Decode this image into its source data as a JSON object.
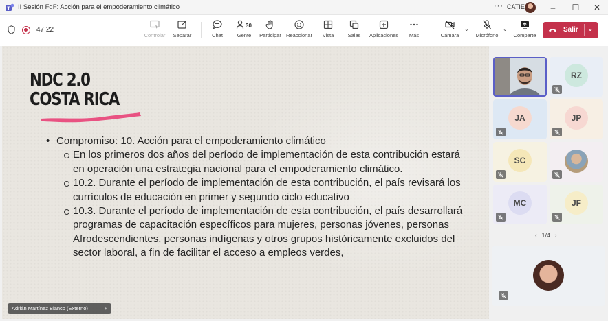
{
  "window": {
    "title": "II Sesión FdF: Acción para el empoderamiento climático",
    "more": "···",
    "org": "CATIE",
    "minimize": "–",
    "maximize": "☐",
    "close": "✕"
  },
  "toolbar": {
    "timer": "47:22",
    "items": {
      "controlar": "Controlar",
      "separar": "Separar",
      "chat": "Chat",
      "gente": "Gente",
      "participar": "Participar",
      "reaccionar": "Reaccionar",
      "vista": "Vista",
      "salas": "Salas",
      "aplicaciones": "Aplicaciones",
      "mas": "Más",
      "camara": "Cámara",
      "microfono": "Micrófono",
      "comparte": "Comparte"
    },
    "people_count": "30",
    "leave_label": "Salir",
    "leave_color": "#c4314b"
  },
  "slide": {
    "title_line1": "NDC 2.0",
    "title_line2": "COSTA RICA",
    "accent_color": "#e8457a",
    "bullet_main": "Compromiso: 10. Acción para el empoderamiento climático",
    "sub_1": "En los primeros dos años del período de implementación de esta contribución estará en operación una estrategia nacional para el empoderamiento climático.",
    "sub_2": "10.2. Durante el período de implementación de esta contribución, el país revisará los currículos de educación en primer y segundo ciclo educativo",
    "sub_3": "10.3. Durante el período de implementación de esta contribución, el país desarrollará programas de capacitación específicos para mujeres, personas jóvenes, personas Afrodescendientes, personas indígenas y otros grupos históricamente excluidos del sector laboral, a fin de facilitar el acceso a empleos verdes,"
  },
  "presenter": {
    "name": "Adrián Martínez Blanco (Externo)",
    "minus": "—",
    "plus": "+"
  },
  "participants": {
    "tiles": [
      {
        "initials": "",
        "bg": "#cfd8e0",
        "kind": "video"
      },
      {
        "initials": "RZ",
        "bg": "#e9eef6",
        "circle": "#cde8de"
      },
      {
        "initials": "JA",
        "bg": "#dde8f4",
        "circle": "#f6d9cf"
      },
      {
        "initials": "JP",
        "bg": "#f7efe4",
        "circle": "#f7d8d2"
      },
      {
        "initials": "SC",
        "bg": "#f6f2e2",
        "circle": "#f5e7b8"
      },
      {
        "initials": "",
        "bg": "#f3eef2",
        "kind": "photo"
      },
      {
        "initials": "MC",
        "bg": "#ecebf6",
        "circle": "#dcdcf2"
      },
      {
        "initials": "JF",
        "bg": "#eef2ea",
        "circle": "#f6edc8"
      }
    ],
    "page": "1/4",
    "prev": "‹",
    "next": "›"
  }
}
